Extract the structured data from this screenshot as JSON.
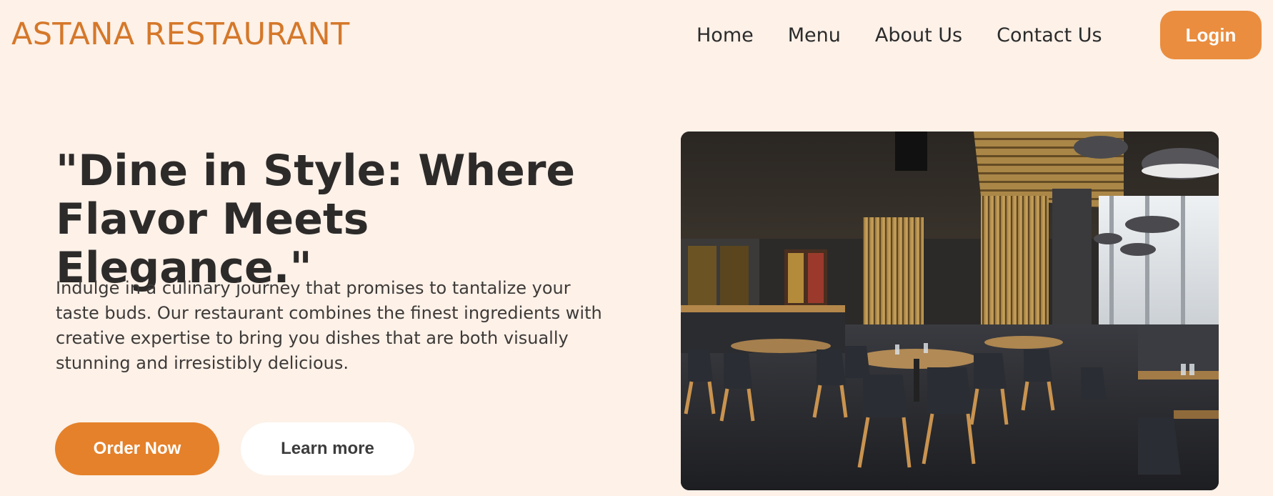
{
  "brand": {
    "name": "ASTANA RESTAURANT"
  },
  "nav": {
    "items": [
      {
        "label": "Home"
      },
      {
        "label": "Menu"
      },
      {
        "label": "About Us"
      },
      {
        "label": "Contact Us"
      }
    ],
    "login_label": "Login"
  },
  "hero": {
    "headline": "\"Dine in Style: Where Flavor Meets Elegance.\"",
    "body": "Indulge in a culinary journey that promises to tantalize your taste buds. Our restaurant combines the finest ingredients with creative expertise to bring you dishes that are both visually stunning and irresistibly delicious.",
    "primary_cta": "Order Now",
    "secondary_cta": "Learn more",
    "image": "restaurant-interior-photo"
  },
  "colors": {
    "background": "#fdf1e8",
    "brand": "#d5782a",
    "login_bg": "#ea8d3f",
    "primary_button": "#e5812a",
    "secondary_button": "#ffffff",
    "heading_text": "#2d2b2a"
  }
}
